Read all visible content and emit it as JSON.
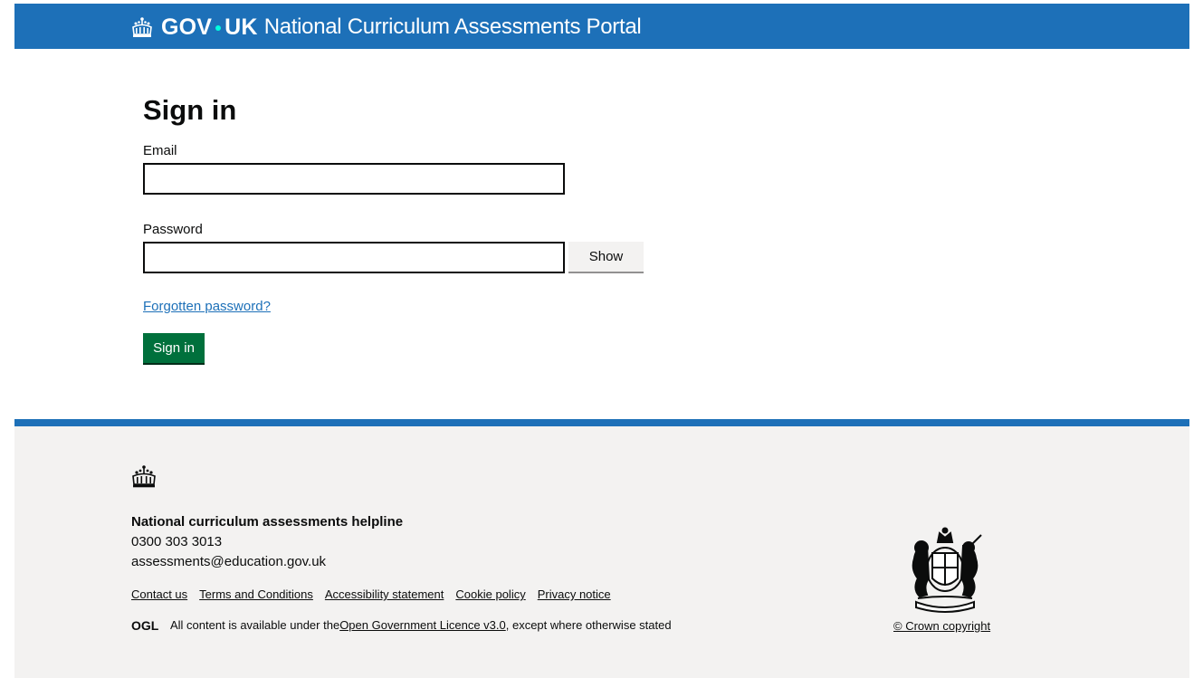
{
  "header": {
    "logotype_gov": "GOV",
    "logotype_uk": "UK",
    "service_name": "National Curriculum Assessments Portal"
  },
  "main": {
    "title": "Sign in",
    "email_label": "Email",
    "email_value": "",
    "password_label": "Password",
    "password_value": "",
    "show_button": "Show",
    "forgot_link": "Forgotten password?",
    "signin_button": "Sign in"
  },
  "footer": {
    "helpline_title": "National curriculum assessments helpline",
    "phone": "0300 303 3013",
    "email": "assessments@education.gov.uk",
    "links": [
      "Contact us",
      "Terms and Conditions",
      "Accessibility statement",
      "Cookie policy",
      "Privacy notice"
    ],
    "licence_prefix": "All content is available under the ",
    "licence_link": "Open Government Licence v3.0",
    "licence_suffix": ", except where otherwise stated",
    "copyright": "© Crown copyright",
    "ogl_logo_text": "OGL"
  },
  "icons": {
    "header_logo": "crown-icon",
    "footer_logo": "crown-icon",
    "licence_logo": "ogl-icon",
    "coat_of_arms": "royal-coat-of-arms-icon"
  },
  "colors": {
    "header_bg": "#1d70b8",
    "accent_dot": "#00ffe0",
    "primary_button": "#00703c",
    "link": "#1d70b8",
    "footer_bg": "#f3f2f1"
  }
}
